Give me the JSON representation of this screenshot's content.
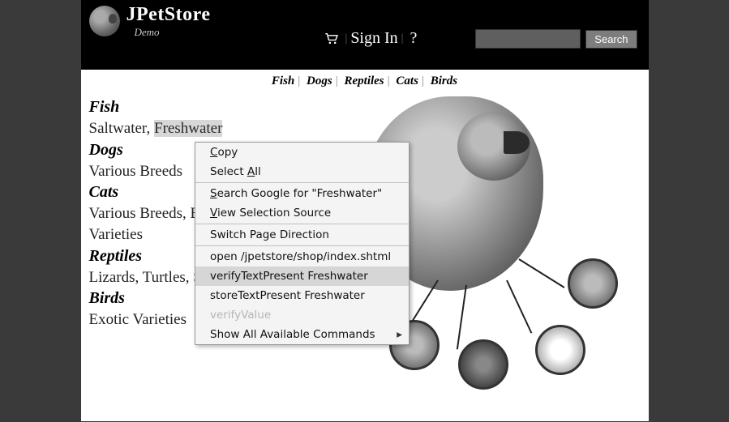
{
  "brand": {
    "title": "JPetStore",
    "subtitle": "Demo"
  },
  "header": {
    "signin": "Sign In",
    "help": "?",
    "search_button": "Search"
  },
  "catbar": [
    "Fish",
    "Dogs",
    "Reptiles",
    "Cats",
    "Birds"
  ],
  "sidebar": {
    "fish": {
      "head": "Fish",
      "sub_a": "Saltwater, ",
      "sub_b": "Freshwater"
    },
    "dogs": {
      "head": "Dogs",
      "sub": "Various Breeds"
    },
    "cats": {
      "head": "Cats",
      "sub": "Various Breeds, Exotic Varieties"
    },
    "reptiles": {
      "head": "Reptiles",
      "sub": "Lizards, Turtles, Snakes"
    },
    "birds": {
      "head": "Birds",
      "sub": "Exotic Varieties"
    }
  },
  "context_menu": {
    "items": [
      {
        "label_pre": "",
        "accel": "C",
        "label_post": "opy"
      },
      {
        "label_pre": "Select ",
        "accel": "A",
        "label_post": "ll"
      }
    ],
    "search_pre": "",
    "search_accel": "S",
    "search_post": "earch Google for \"Freshwater\"",
    "view_pre": "",
    "view_accel": "V",
    "view_post": "iew Selection Source",
    "switch": "Switch Page Direction",
    "open": "open /jpetstore/shop/index.shtml",
    "verify": "verifyTextPresent Freshwater",
    "store": "storeTextPresent Freshwater",
    "verifyValue": "verifyValue",
    "showall": "Show All Available Commands"
  }
}
